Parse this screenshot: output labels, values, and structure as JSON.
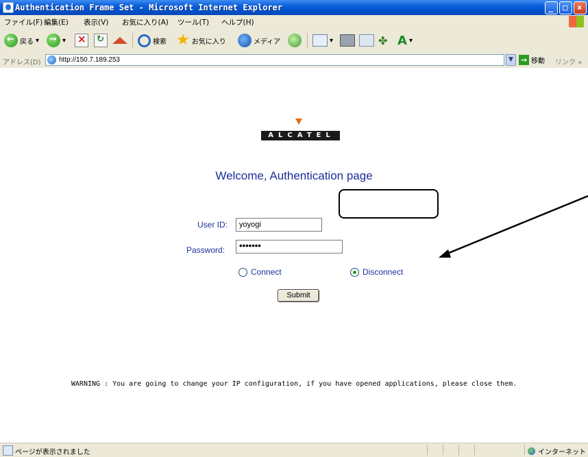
{
  "window": {
    "title": "Authentication Frame Set - Microsoft Internet Explorer"
  },
  "menu": {
    "items": [
      "ファイル(F)",
      "編集(E)",
      "表示(V)",
      "お気に入り(A)",
      "ツール(T)",
      "ヘルプ(H)"
    ]
  },
  "toolbar": {
    "back_label": "戻る",
    "search_label": "検索",
    "favorites_label": "お気に入り",
    "media_label": "メディア"
  },
  "address": {
    "label": "アドレス(D)",
    "url": "http://150.7.189.253",
    "go_label": "移動",
    "links_label": "リンク »"
  },
  "page": {
    "logo_text": "ALCATEL",
    "welcome": "Welcome, Authentication page",
    "userid_label": "User ID:",
    "userid_value": "yoyogi",
    "password_label": "Password:",
    "password_value": "•••••••",
    "connect_label": "Connect",
    "disconnect_label": "Disconnect",
    "selected_option": "Disconnect",
    "submit_label": "Submit",
    "warning": "WARNING : You are going to change your IP configuration, if you have opened applications, please close them."
  },
  "status": {
    "message": "ページが表示されました",
    "zone": "インターネット"
  },
  "colors": {
    "title_blue": "#0052cc",
    "form_text": "#1b2f99",
    "logo_accent": "#e86a10"
  }
}
